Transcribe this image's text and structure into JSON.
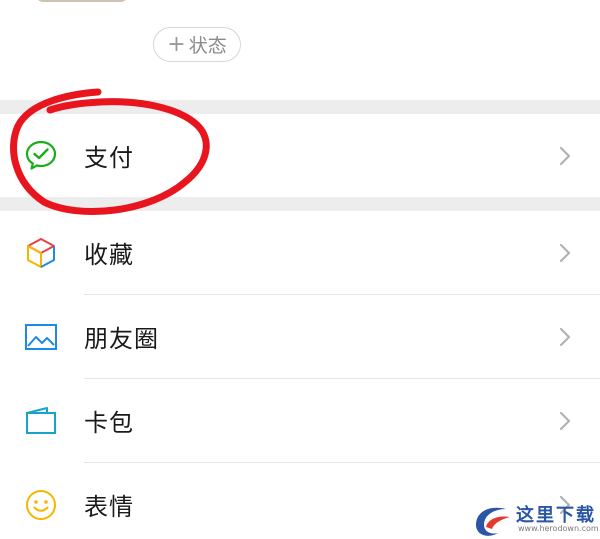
{
  "profile": {
    "status_button": {
      "plus": "+",
      "label": "状态"
    }
  },
  "menu": {
    "pay": {
      "label": "支付",
      "icon": "wechat-pay-icon"
    },
    "items": [
      {
        "label": "收藏",
        "icon": "favorites-cube-icon"
      },
      {
        "label": "朋友圈",
        "icon": "moments-photo-icon"
      },
      {
        "label": "卡包",
        "icon": "card-wallet-icon"
      },
      {
        "label": "表情",
        "icon": "emoji-smiley-icon"
      }
    ]
  },
  "annotation": {
    "highlight_color": "#e8141e"
  },
  "watermark": {
    "text": "这里下载",
    "url": "www.herodown.com"
  },
  "colors": {
    "section_gap": "#ededed",
    "wechat_green": "#1aad19",
    "chevron": "#b2b2b2"
  }
}
